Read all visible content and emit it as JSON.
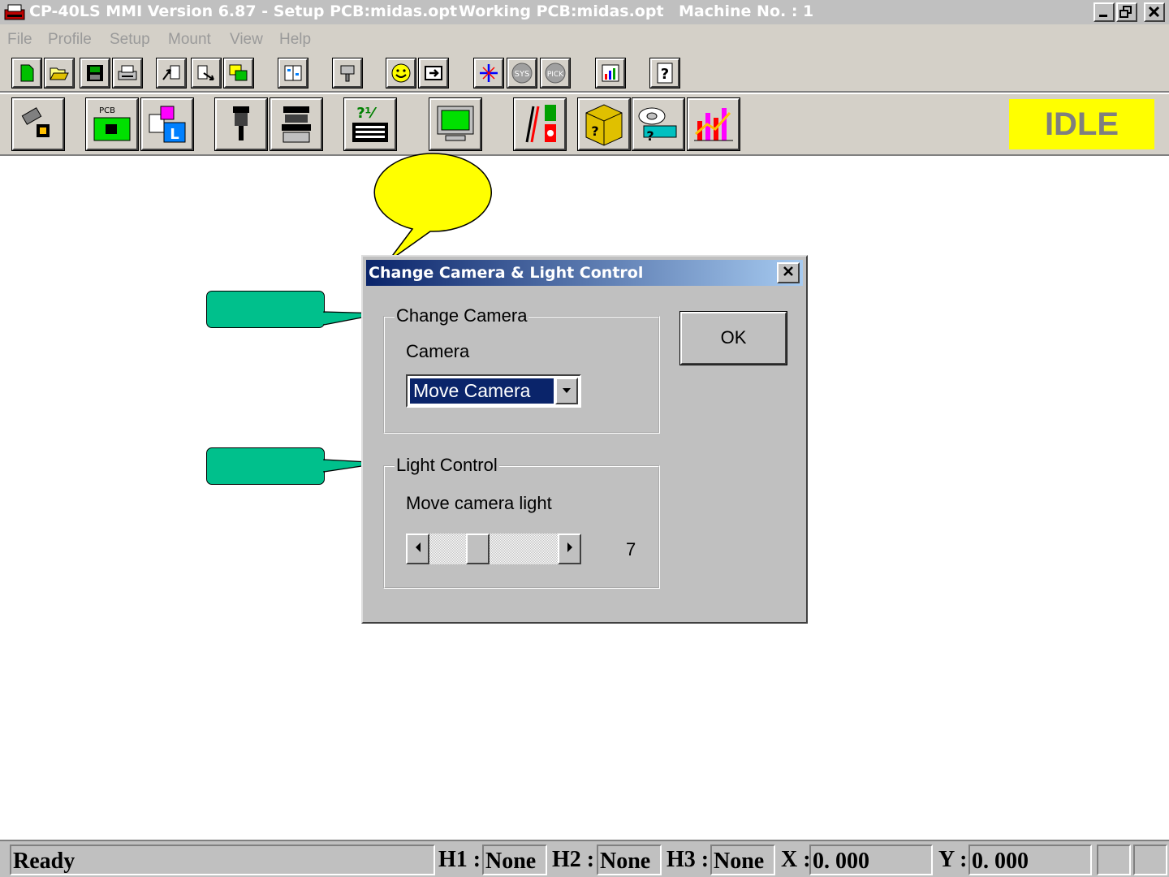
{
  "window": {
    "app_title": "CP-40LS MMI Version 6.87 - Setup PCB:midas.opt",
    "working_pcb": "Working PCB:midas.opt",
    "machine": "Machine No. : 1",
    "minimize": "_",
    "restore": "͉",
    "close": "✕"
  },
  "menu": {
    "items": [
      "File",
      "Profile",
      "Setup",
      "Mount",
      "View",
      "Help"
    ]
  },
  "toolbar1": {
    "icons": [
      "new-icon",
      "open-icon",
      "save-icon",
      "print-icon",
      "import-icon",
      "export-icon",
      "copy-icon",
      "compare-icon",
      "nozzle-icon",
      "smile-icon",
      "run-icon",
      "origin-icon",
      "sys-icon",
      "pick-icon",
      "report-icon",
      "help-icon"
    ],
    "sys_text": "SYS",
    "pick_text": "PICK",
    "help_text": "?"
  },
  "toolbar2": {
    "icons": [
      "component-icon",
      "pcb-icon",
      "layout-icon",
      "nozzle-head-icon",
      "feeder-icon",
      "keypad-icon",
      "monitor-icon",
      "io-icon",
      "parts-box-icon",
      "tape-reel-icon",
      "statistics-icon"
    ],
    "pcb_text": "PCB",
    "keypad_text": "?⅟",
    "idle_label": "IDLE"
  },
  "dialog": {
    "title": "Change Camera & Light Control",
    "close_label": "✕",
    "camera_group": "Change Camera",
    "camera_label": "Camera",
    "camera_value": "Move Camera",
    "light_group": "Light Control",
    "light_label": "Move camera light",
    "light_value": "7",
    "light_level_fraction": 0.35,
    "ok_label": "OK"
  },
  "statusbar": {
    "status": "Ready",
    "h1_label": "H1 :",
    "h1_value": "None",
    "h2_label": "H2 :",
    "h2_value": "None",
    "h3_label": "H3 :",
    "h3_value": "None",
    "x_label": "X :",
    "x_value": "0. 000",
    "y_label": "Y :",
    "y_value": "0. 000"
  },
  "colors": {
    "idle_bg": "#ffff00",
    "callout_green": "#00c08c",
    "callout_yellow": "#ffff00",
    "title_gradient_start": "#0a246a"
  }
}
